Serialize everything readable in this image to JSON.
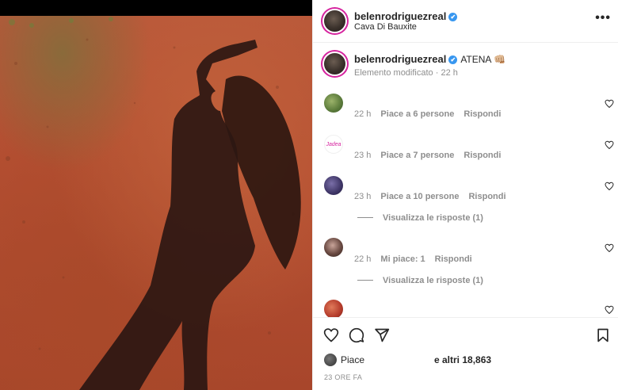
{
  "post": {
    "username": "belenrodriguezreal",
    "location": "Cava Di Bauxite",
    "verified_mark": "✔",
    "more_icon": "more-horizontal-icon"
  },
  "caption": {
    "username": "belenrodriguezreal",
    "text": "ATENA 👊🏼",
    "edited": "Elemento modificato",
    "time": "22 h"
  },
  "comments": [
    {
      "time": "22 h",
      "likes": "Piace a 6 persone",
      "reply": "Rispondi",
      "avatar_color": "#6d8b4a"
    },
    {
      "time": "23 h",
      "likes": "Piace a 7 persone",
      "reply": "Rispondi",
      "avatar_text": "Jadea",
      "avatar_color": "#ffffff"
    },
    {
      "time": "23 h",
      "likes": "Piace a 10 persone",
      "reply": "Rispondi",
      "avatar_color": "#4a3f6b",
      "view_replies": "Visualizza le risposte (1)"
    },
    {
      "time": "22 h",
      "likes": "Mi piace: 1",
      "reply": "Rispondi",
      "avatar_color": "#5a3f3a",
      "view_replies": "Visualizza le risposte (1)"
    },
    {
      "avatar_color": "#c24a3a"
    }
  ],
  "footer": {
    "liked_by": "Piace",
    "others": "e altri 18,863",
    "date": "23 ORE FA"
  },
  "colors": {
    "ring": "#d6249f",
    "verified": "#3897f0",
    "muted": "#8e8e8e",
    "ground": "#b5512f"
  }
}
